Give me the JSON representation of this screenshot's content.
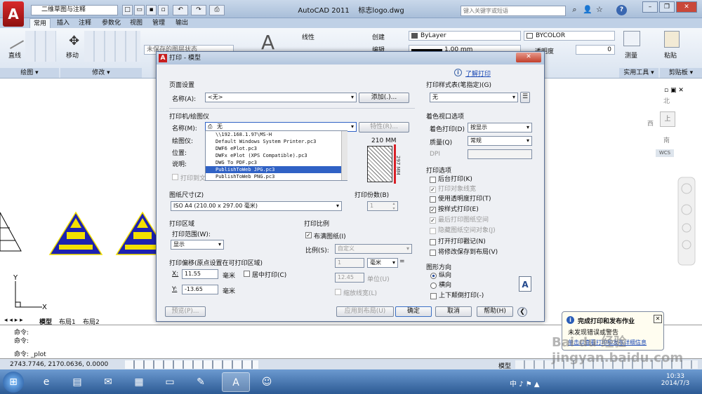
{
  "app": {
    "title": "AutoCAD 2011",
    "document": "标志logo.dwg",
    "logo_letter": "A",
    "workspace": "二维草图与注释",
    "search_placeholder": "键入关键字或短语"
  },
  "ribbon": {
    "tabs": [
      "常用",
      "插入",
      "注释",
      "参数化",
      "视图",
      "管理",
      "输出"
    ],
    "draw_label": "直线",
    "modify_label": "移动",
    "linetype_label": "线性",
    "create_label": "创建",
    "edit_label": "编辑",
    "layer_status": "未保存的图层状态",
    "bylayer": "ByLayer",
    "bycolor": "BYCOLOR",
    "lineweight": "1.00 mm",
    "transparency_label": "透明度",
    "transparency_value": "0",
    "measure_label": "测量",
    "paste_label": "粘贴",
    "panels": {
      "draw": "绘图",
      "modify": "修改",
      "utilities": "实用工具",
      "clipboard": "剪贴板"
    }
  },
  "viewcube": {
    "north": "北",
    "south": "南",
    "west": "西",
    "top": "上",
    "wcs": "WCS"
  },
  "layout_tabs": [
    "模型",
    "布局1",
    "布局2"
  ],
  "command": {
    "line1": "命令:",
    "line2": "命令:",
    "prompt": "命令: _plot"
  },
  "status": {
    "coords": "2743.7746, 2170.0636, 0.0000",
    "model": "模型"
  },
  "dialog": {
    "title": "打印 - 模型",
    "help_link": "了解打印",
    "page_setup": {
      "group": "页面设置",
      "name_label": "名称(A):",
      "name_value": "<无>",
      "add_button": "添加(.)..."
    },
    "printer": {
      "group": "打印机/绘图仪",
      "name_label": "名称(M):",
      "name_value": "无",
      "properties_button": "特性(R)...",
      "plotter_label": "绘图仪:",
      "location_label": "位置:",
      "description_label": "说明:",
      "print_to_file": "打印到文件(F)",
      "options": [
        "\\\\192.168.1.97\\MS-H",
        "Default Windows System Printer.pc3",
        "DWF6 ePlot.pc3",
        "DWFx ePlot (XPS Compatible).pc3",
        "DWG To PDF.pc3",
        "PublishToWeb JPG.pc3",
        "PublishToWeb PNG.pc3"
      ],
      "selected_option": "PublishToWeb JPG.pc3",
      "preview_width": "210 MM",
      "preview_height": "297 MM"
    },
    "paper_size": {
      "group": "图纸尺寸(Z)",
      "value": "ISO A4 (210.00 x 297.00 毫米)"
    },
    "copies": {
      "group": "打印份数(B)",
      "value": "1"
    },
    "area": {
      "group": "打印区域",
      "range_label": "打印范围(W):",
      "range_value": "显示"
    },
    "offset": {
      "group": "打印偏移(原点设置在可打印区域)",
      "x_label": "X:",
      "x_value": "11.55",
      "y_label": "Y:",
      "y_value": "-13.65",
      "unit": "毫米",
      "center_label": "居中打印(C)"
    },
    "scale": {
      "group": "打印比例",
      "fit_label": "布满图纸(I)",
      "ratio_label": "比例(S):",
      "ratio_value": "自定义",
      "v1": "1",
      "unit_combo": "毫米",
      "v2": "12.45",
      "unit_label": "单位(U)",
      "scale_lw": "缩放线宽(L)"
    },
    "plot_style": {
      "group": "打印样式表(笔指定)(G)",
      "value": "无"
    },
    "shaded": {
      "group": "着色视口选项",
      "shade_label": "着色打印(D)",
      "shade_value": "按显示",
      "quality_label": "质量(Q)",
      "quality_value": "常规",
      "dpi_label": "DPI"
    },
    "options": {
      "group": "打印选项",
      "items": [
        "后台打印(K)",
        "打印对象线宽",
        "使用透明度打印(T)",
        "按样式打印(E)",
        "最后打印图纸空间",
        "隐藏图纸空间对象(J)",
        "打开打印戳记(N)",
        "将修改保存到布局(V)"
      ]
    },
    "orientation": {
      "group": "图形方向",
      "portrait": "纵向",
      "landscape": "横向",
      "upside_down": "上下颠倒打印(-)"
    },
    "buttons": {
      "preview": "预览(P)...",
      "apply": "应用到布局(U)",
      "ok": "确定",
      "cancel": "取消",
      "help": "帮助(H)"
    }
  },
  "balloon": {
    "title": "完成打印和发布作业",
    "line1": "未发现错误或警告",
    "line2": "单击以查看打印和发布详细信息"
  },
  "taskbar": {
    "time": "10:33",
    "date": "2014/7/3",
    "ime": "中"
  },
  "watermark": "Bai du 经验 jingyan.baidu.com",
  "colors": {
    "accent": "#3062c5",
    "emblem_blue": "#1d21b0",
    "emblem_yellow": "#f3e000",
    "border_red": "#d81f26"
  }
}
